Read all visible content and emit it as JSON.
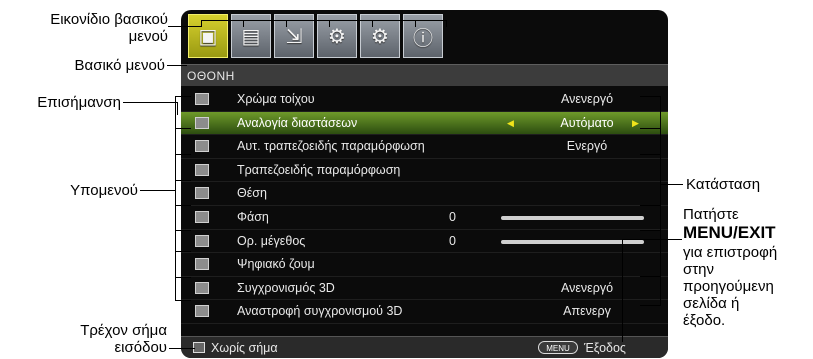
{
  "callouts": {
    "main_menu_icon": "Εικονίδιο βασικού\nμενού",
    "main_menu": "Βασικό μενού",
    "highlight": "Επισήμανση",
    "submenu": "Υπομενού",
    "current_input": "Τρέχον σήμα\nεισόδου",
    "status": "Κατάσταση",
    "press_pre": "Πατήστε",
    "press_key": "MENU/EXIT",
    "press_post": "για επιστροφή\nστην\nπροηγούμενη\nσελίδα ή\nέξοδο."
  },
  "tabs": [
    {
      "icon": "display-icon",
      "glyph": "▣"
    },
    {
      "icon": "picture-icon",
      "glyph": "▤"
    },
    {
      "icon": "source-icon",
      "glyph": "⇲"
    },
    {
      "icon": "system-setup-basic-icon",
      "glyph": "⚙"
    },
    {
      "icon": "system-setup-advanced-icon",
      "glyph": "⚙"
    },
    {
      "icon": "information-icon",
      "glyph": "ⓘ"
    }
  ],
  "menu_title": "ΟΘΟΝΗ",
  "rows": [
    {
      "label": "Χρώμα τοίχου",
      "value": "Ανενεργό"
    },
    {
      "label": "Αναλογία διαστάσεων",
      "value": "Αυτόματο"
    },
    {
      "label": "Αυτ. τραπεζοειδής παραμόρφωση",
      "value": "Ενεργό"
    },
    {
      "label": "Τραπεζοειδής παραμόρφωση",
      "value": ""
    },
    {
      "label": "Θέση",
      "value": ""
    },
    {
      "label": "Φάση",
      "number": "0"
    },
    {
      "label": "Ορ. μέγεθος",
      "number": "0"
    },
    {
      "label": "Ψηφιακό ζουμ",
      "value": ""
    },
    {
      "label": "Συγχρονισμός 3D",
      "value": "Ανενεργό"
    },
    {
      "label": "Αναστροφή συγχρονισμού 3D",
      "value": "Απενεργ"
    }
  ],
  "highlighted_row": 1,
  "status_bar": {
    "source_text": "Χωρίς σήμα",
    "menu_button": "MENU",
    "exit_text": "Έξοδος"
  },
  "colors": {
    "highlight": "#5a8a1e",
    "active_tab": "#d7d12e",
    "arrow": "#f1e41b"
  }
}
